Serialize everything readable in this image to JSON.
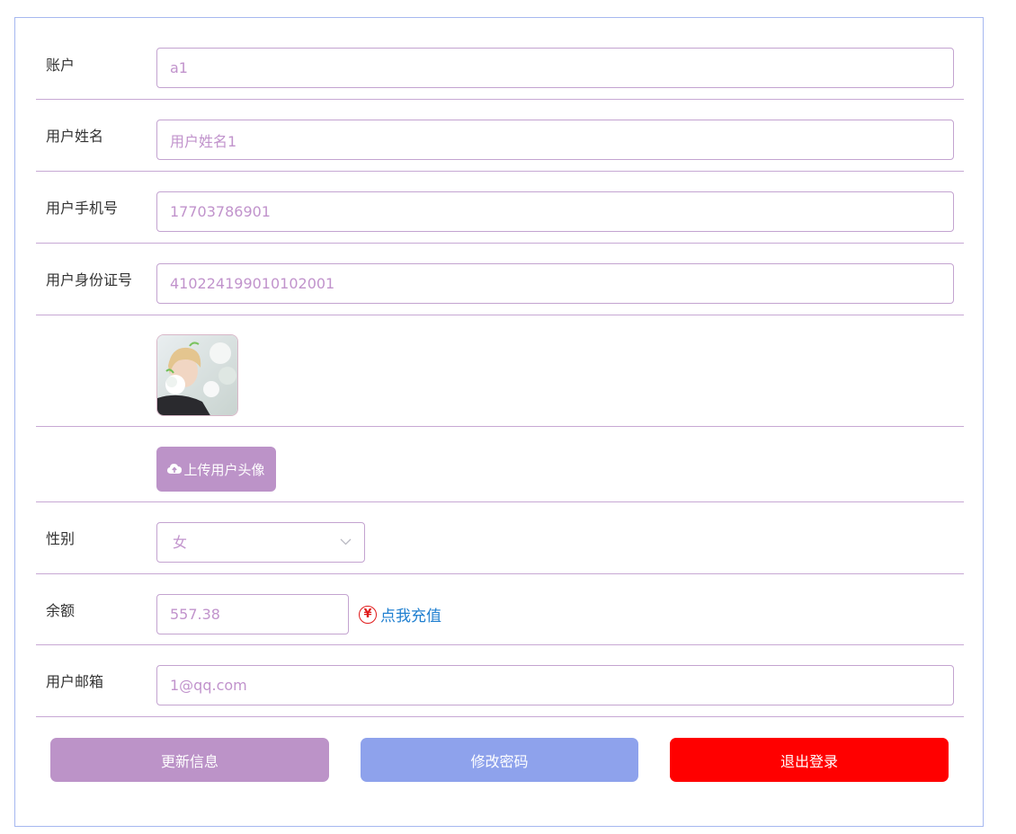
{
  "form": {
    "account": {
      "label": "账户",
      "value": "a1"
    },
    "name": {
      "label": "用户姓名",
      "value": "用户姓名1"
    },
    "phone": {
      "label": "用户手机号",
      "value": "17703786901"
    },
    "id_card": {
      "label": "用户身份证号",
      "value": "410224199010102001"
    },
    "upload_label": "上传用户头像",
    "gender": {
      "label": "性别",
      "value": "女"
    },
    "balance": {
      "label": "余额",
      "value": "557.38",
      "recharge_text": "点我充值",
      "currency_symbol": "¥"
    },
    "email": {
      "label": "用户邮箱",
      "value": "1@qq.com"
    }
  },
  "actions": {
    "update_label": "更新信息",
    "change_password_label": "修改密码",
    "logout_label": "退出登录"
  },
  "colors": {
    "accent": "#bc93c8",
    "password_button": "#8ea2ec",
    "logout_button": "#ff0000",
    "field_text": "#c193cc",
    "link": "#1f7fd0"
  }
}
